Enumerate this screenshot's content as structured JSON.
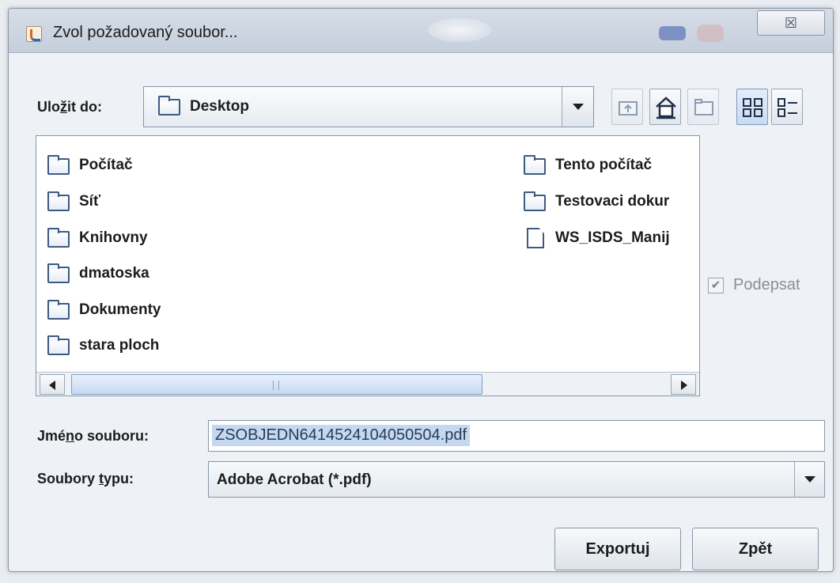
{
  "window": {
    "title": "Zvol požadovaný soubor...",
    "close_symbol": "☒"
  },
  "save_in": {
    "label_prefix": "Ulo",
    "label_mnemonic": "ž",
    "label_suffix": "it do:",
    "current_folder": "Desktop"
  },
  "toolbar": {
    "buttons": [
      {
        "name": "up-one-level-button",
        "icon": "folder-up-icon",
        "enabled": false
      },
      {
        "name": "home-button",
        "icon": "home-icon",
        "enabled": true
      },
      {
        "name": "new-folder-button",
        "icon": "new-folder-icon",
        "enabled": false
      },
      {
        "name": "list-view-button",
        "icon": "list-view-icon",
        "enabled": true,
        "active": true
      },
      {
        "name": "details-view-button",
        "icon": "details-view-icon",
        "enabled": true
      }
    ]
  },
  "files": {
    "left_column": [
      "Počítač",
      "Síť",
      "Knihovny",
      "dmatoska",
      "Dokumenty",
      "stara ploch"
    ],
    "right_column": [
      "Tento počítač",
      "Testovaci dokur",
      "WS_ISDS_Manij"
    ]
  },
  "sign_checkbox": {
    "label": "Podepsat",
    "checked": true,
    "enabled": false
  },
  "file_name": {
    "label_prefix": "Jmé",
    "label_mnemonic": "n",
    "label_suffix": "o souboru:",
    "value": "ZSOBJEDN6414524104050504.pdf"
  },
  "file_type": {
    "label_prefix": "Soubory ",
    "label_mnemonic": "t",
    "label_suffix": "ypu:",
    "value": "Adobe Acrobat (*.pdf)"
  },
  "actions": {
    "export_label": "Exportuj",
    "back_label": "Zpět"
  }
}
